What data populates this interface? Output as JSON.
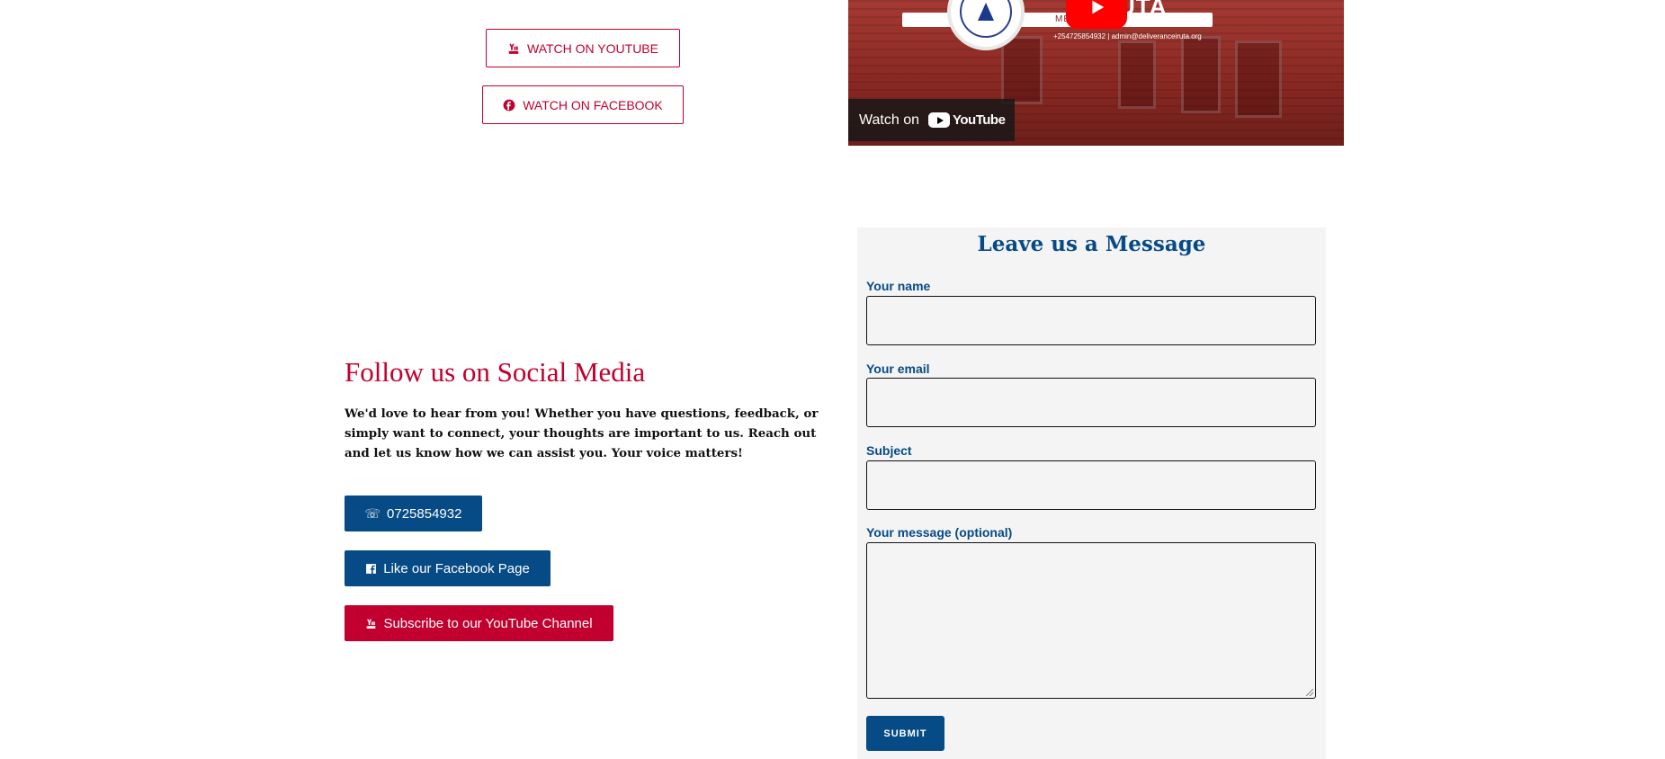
{
  "watch_buttons": {
    "youtube_label": "WATCH ON YOUTUBE",
    "facebook_label": "WATCH ON FACEBOOK"
  },
  "video": {
    "title_fragment": "UTA",
    "tagline_fragment": "ME OF HOPE",
    "contact_line": "+254725854932  |  admin@deliveranceiruta.org",
    "watch_on_label": "Watch on",
    "youtube_wordmark": "YouTube"
  },
  "social": {
    "heading": "Follow us on Social Media",
    "text": "We'd love to hear from you! Whether you have questions, feedback, or simply want to connect, your thoughts are important to us. Reach out and let us know how we can assist you. Your voice matters!",
    "phone_label": "0725854932",
    "facebook_label": "Like our Facebook Page",
    "youtube_label": "Subscribe to our YouTube Channel"
  },
  "form": {
    "title": "Leave us a Message",
    "name_label": "Your name",
    "email_label": "Your email",
    "subject_label": "Subject",
    "message_label": "Your message (optional)",
    "submit_label": "SUBMIT"
  },
  "icons": {
    "youtube": "youtube-icon",
    "facebook": "facebook-icon",
    "phone": "phone-icon",
    "play": "play-icon"
  },
  "colors": {
    "brand_red": "#c1002f",
    "brand_blue": "#064a86",
    "panel_bg": "#f4f4f4"
  }
}
